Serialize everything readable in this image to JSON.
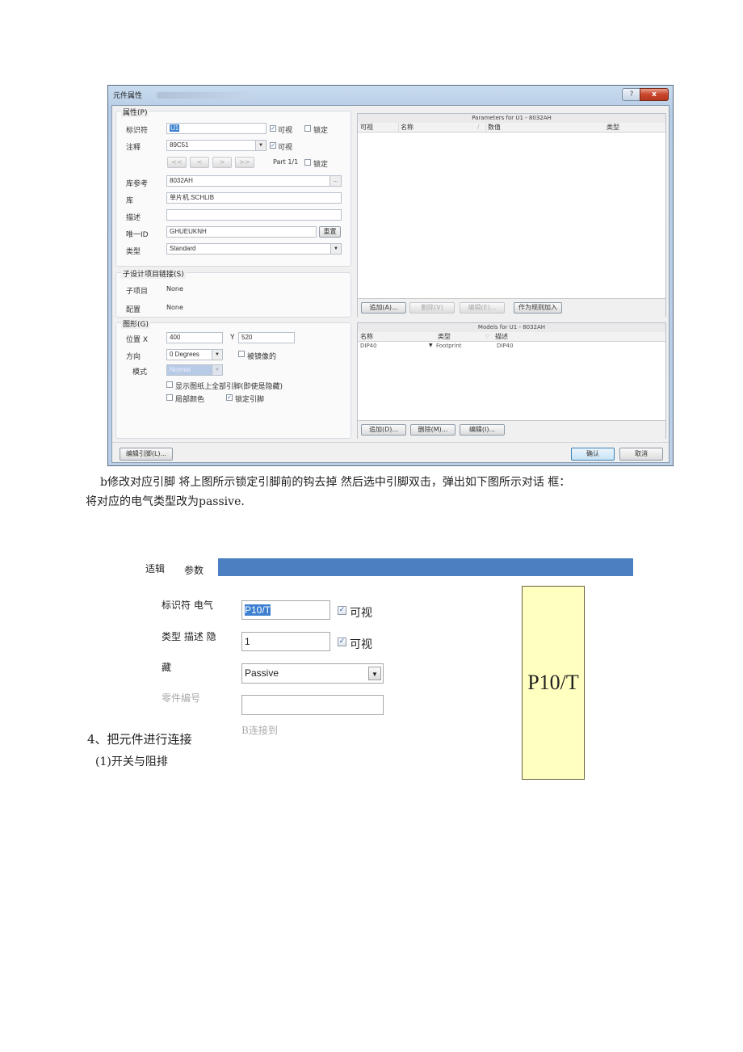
{
  "dialog": {
    "title": "元件属性",
    "help_label": "?",
    "close_label": "x",
    "properties": {
      "group_label": "属性(P)",
      "designator_label": "标识符",
      "designator_value": "U1",
      "designator_visible_label": "可视",
      "designator_visible": true,
      "designator_locked_label": "锁定",
      "designator_locked": false,
      "comment_label": "注释",
      "comment_value": "89C51",
      "comment_visible_label": "可视",
      "comment_visible": true,
      "nav_buttons": [
        "<<",
        "<",
        ">",
        ">>"
      ],
      "part_label": "Part 1/1",
      "part_locked_label": "锁定",
      "part_locked": false,
      "libref_label": "库参考",
      "libref_value": "8032AH",
      "libref_browse": "...",
      "library_label": "库",
      "library_value": "单片机.SCHLIB",
      "description_label": "描述",
      "description_value": "",
      "uid_label": "唯一ID",
      "uid_value": "GHUEUKNH",
      "reset_label": "重置",
      "type_label": "类型",
      "type_value": "Standard"
    },
    "subdesign": {
      "group_label": "子设计项目链接(S)",
      "subproject_label": "子项目",
      "subproject_value": "None",
      "config_label": "配置",
      "config_value": "None"
    },
    "graphical": {
      "group_label": "图形(G)",
      "pos_x_label": "位置 X",
      "pos_x_value": "400",
      "pos_y_label": "Y",
      "pos_y_value": "520",
      "orientation_label": "方向",
      "orientation_value": "0 Degrees",
      "mirrored_label": "被镜像的",
      "mirrored": false,
      "mode_label": "模式",
      "mode_value": "Normal",
      "show_all_pins_label": "显示图纸上全部引脚(即使是隐藏)",
      "show_all_pins": false,
      "local_colors_label": "局部颜色",
      "local_colors": false,
      "lock_pins_label": "锁定引脚",
      "lock_pins": true
    },
    "parameters": {
      "caption": "Parameters for U1 - 8032AH",
      "columns": [
        "可视",
        "名称",
        "/",
        "数值",
        "类型"
      ],
      "rows": [],
      "buttons": [
        "追加(A)...",
        "删除(V)",
        "编辑(E)...",
        "作为规则加入"
      ]
    },
    "models": {
      "caption": "Models for U1 - 8032AH",
      "columns": [
        "名称",
        "类型",
        "描述"
      ],
      "rows": [
        {
          "name": "DIP40",
          "type": "Footprint",
          "description": "DIP40"
        }
      ],
      "buttons": [
        "追加(D)...",
        "删除(M)...",
        "编辑(I)..."
      ]
    },
    "footer": {
      "edit_pins_label": "编辑引脚(L)...",
      "ok_label": "确认",
      "cancel_label": "取消"
    }
  },
  "paragraph": {
    "line1": "b修改对应引脚 将上图所示锁定引脚前的钩去掉 然后选中引脚双击，弹出如下图所示对话 框：",
    "line2": "将对应的电气类型改为passive."
  },
  "pin_dialog": {
    "tab_logic": "适辑",
    "tab_params": "参数",
    "header_color": "#4a7fc1",
    "row1_label": "标识符 电气",
    "designator_value": "P10/T",
    "visible1_label": "可视",
    "visible1": true,
    "row2_label": "类型 描述 隐",
    "description_value": "1",
    "visible2_label": "可视",
    "visible2": true,
    "row3_label": "藏",
    "electrical_type": "Passive",
    "part_number_label": "零件编号",
    "part_number_value": "",
    "connect_label": "B连接到",
    "preview_text": "P10/T",
    "preview_fill": "#ffffc0"
  },
  "section": {
    "heading": "4、把元件进行连接",
    "subheading": "(1)开关与阻排"
  }
}
